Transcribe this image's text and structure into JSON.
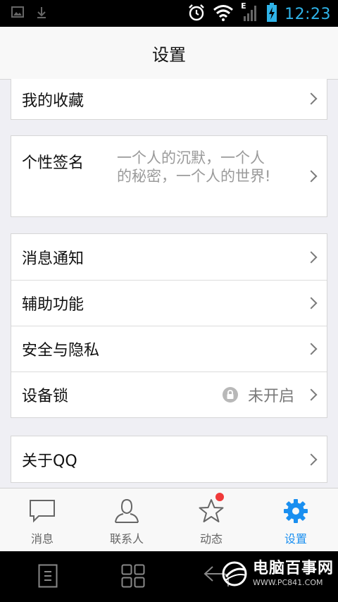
{
  "status_bar": {
    "time": "12:23",
    "network_label": "E",
    "icons": [
      "image-icon",
      "download-icon",
      "alarm-icon",
      "wifi-icon",
      "signal-icon",
      "battery-charging-icon"
    ]
  },
  "header": {
    "title": "设置"
  },
  "settings": {
    "favorites": "我的收藏",
    "signature": {
      "label": "个性签名",
      "value": "一个人的沉默，一个人的秘密，一个人的世界!"
    },
    "notifications": "消息通知",
    "accessibility": "辅助功能",
    "security_privacy": "安全与隐私",
    "device_lock": {
      "label": "设备锁",
      "status": "未开启"
    },
    "about": "关于QQ"
  },
  "tabs": [
    {
      "label": "消息",
      "icon": "message-icon"
    },
    {
      "label": "联系人",
      "icon": "contacts-icon"
    },
    {
      "label": "动态",
      "icon": "star-icon"
    },
    {
      "label": "设置",
      "icon": "gear-icon"
    }
  ],
  "watermark": {
    "name": "电脑百事网",
    "url": "WWW.PC841.COM"
  },
  "colors": {
    "accent": "#1a8ff0",
    "status_blue": "#2fb3e8",
    "badge": "#f03a3a",
    "background": "#efeff4"
  }
}
